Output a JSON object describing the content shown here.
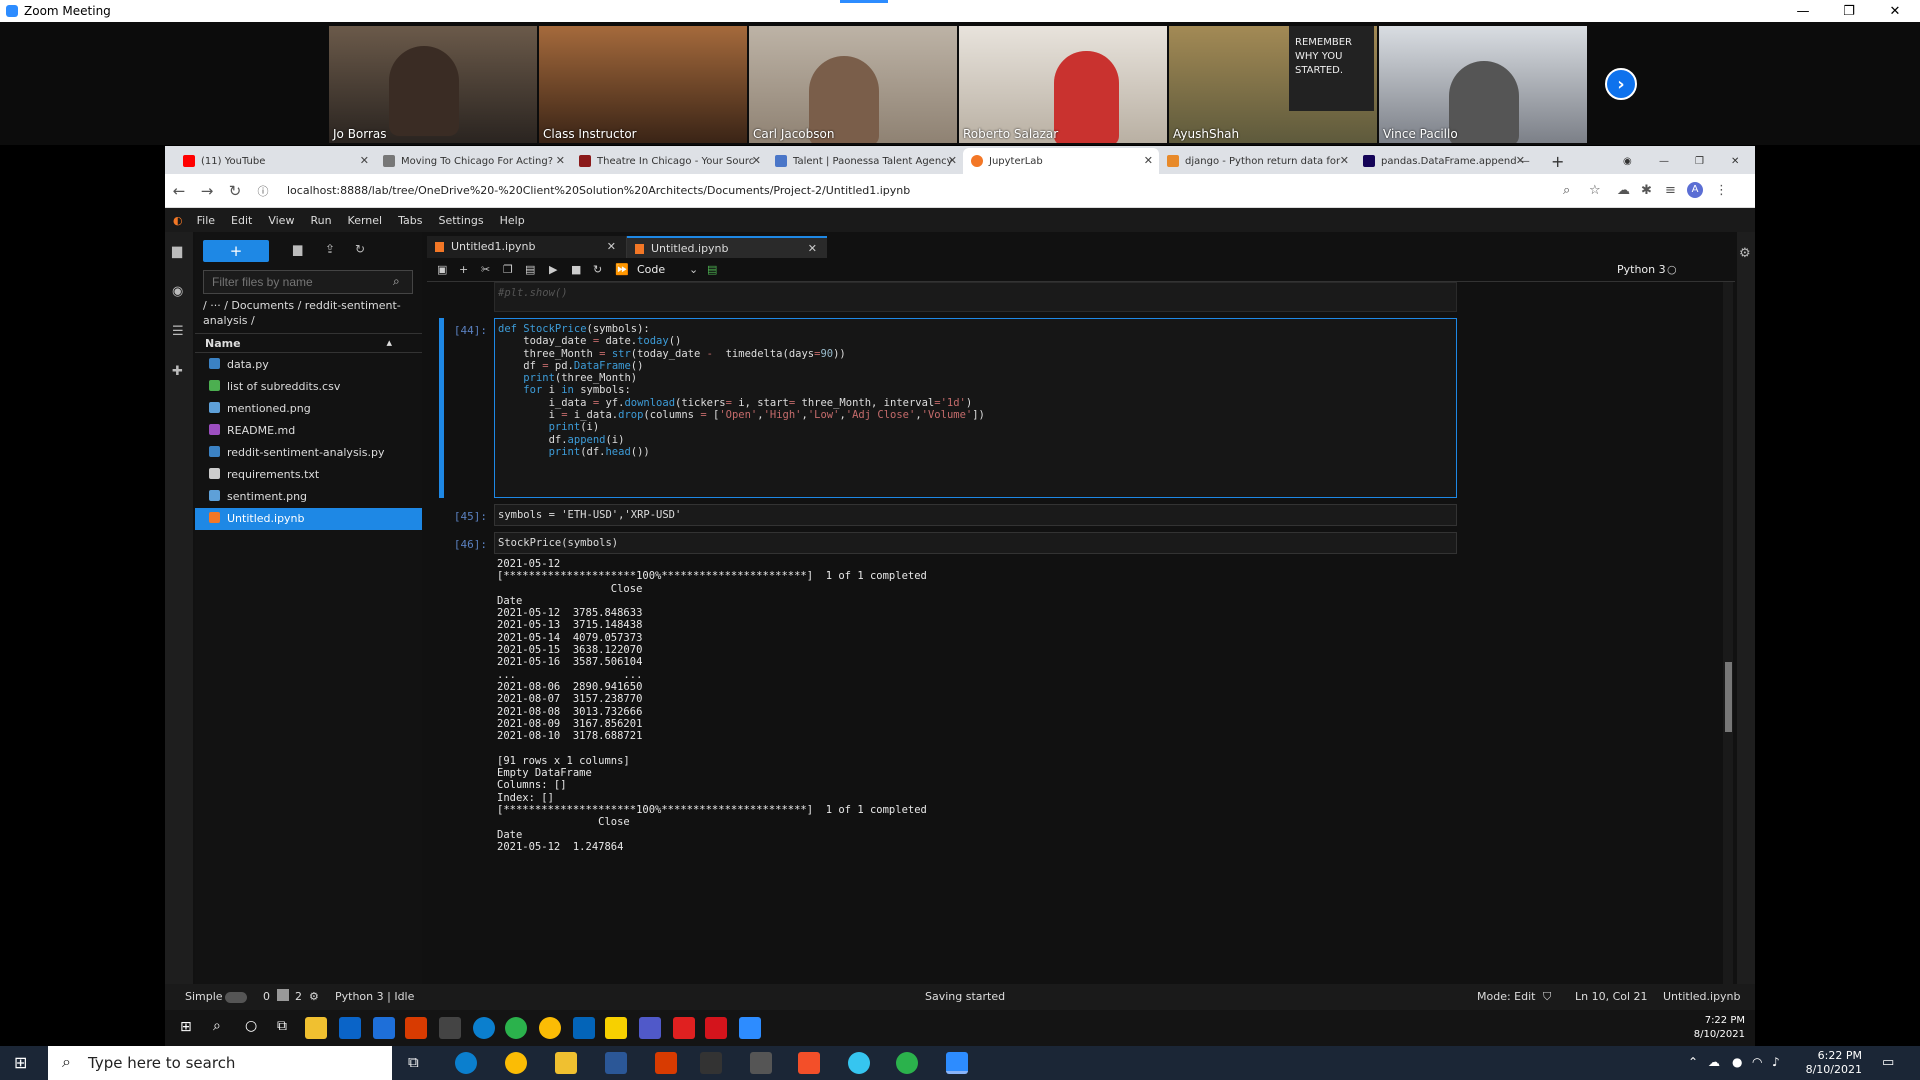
{
  "zoom": {
    "title": "Zoom Meeting",
    "participants": [
      "Jo Borras",
      "Class Instructor",
      "Carl Jacobson",
      "Roberto Salazar",
      "AyushShah",
      "Vince Pacillo"
    ],
    "poster_text": "REMEMBER\nWHY YOU\nSTARTED."
  },
  "browser": {
    "tabs": [
      "(11) YouTube",
      "Moving To Chicago For Acting?",
      "Theatre In Chicago - Your Sourc",
      "Talent | Paonessa Talent Agency",
      "JupyterLab",
      "django - Python return data for",
      "pandas.DataFrame.append — p"
    ],
    "url": "localhost:8888/lab/tree/OneDrive%20-%20Client%20Solution%20Architects/Documents/Project-2/Untitled1.ipynb"
  },
  "jupyter": {
    "menu": [
      "File",
      "Edit",
      "View",
      "Run",
      "Kernel",
      "Tabs",
      "Settings",
      "Help"
    ],
    "filter_placeholder": "Filter files by name",
    "breadcrumb": "/ ··· / Documents / reddit-sentiment-analysis /",
    "column_header": "Name",
    "files": [
      "data.py",
      "list of subreddits.csv",
      "mentioned.png",
      "README.md",
      "reddit-sentiment-analysis.py",
      "requirements.txt",
      "sentiment.png",
      "Untitled.ipynb"
    ],
    "nb_tabs": [
      "Untitled1.ipynb",
      "Untitled.ipynb"
    ],
    "cell_type": "Code",
    "kernel": "Python 3",
    "prompts": [
      "[44]:",
      "[45]:",
      "[46]:"
    ],
    "prev_code": "#plt.show()",
    "cell45": "symbols = 'ETH-USD','XRP-USD'",
    "cell46": "StockPrice(symbols)",
    "output": "2021-05-12\n[*********************100%***********************]  1 of 1 completed\n                  Close\nDate\n2021-05-12  3785.848633\n2021-05-13  3715.148438\n2021-05-14  4079.057373\n2021-05-15  3638.122070\n2021-05-16  3587.506104\n...                 ...\n2021-08-06  2890.941650\n2021-08-07  3157.238770\n2021-08-08  3013.732666\n2021-08-09  3167.856201\n2021-08-10  3178.688721\n\n[91 rows x 1 columns]\nEmpty DataFrame\nColumns: []\nIndex: []\n[*********************100%***********************]  1 of 1 completed\n                Close\nDate\n2021-05-12  1.247864",
    "status": {
      "mode_label": "Simple",
      "count_a": "0",
      "count_b": "2",
      "kernel_state": "Python 3 | Idle",
      "message": "Saving started",
      "mode": "Mode: Edit",
      "position": "Ln 10, Col 21",
      "filename": "Untitled.ipynb"
    }
  },
  "taskbar": {
    "search_placeholder": "Type here to search",
    "time": "6:22 PM",
    "date": "8/10/2021",
    "inner_time": "7:22 PM",
    "inner_date": "8/10/2021"
  }
}
